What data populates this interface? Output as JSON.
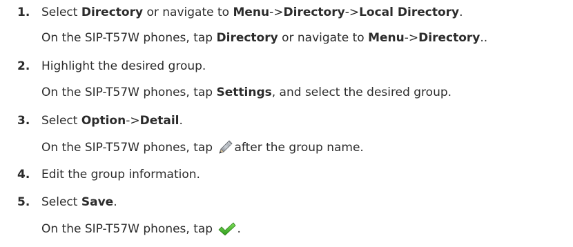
{
  "steps": [
    {
      "num": "1.",
      "main": {
        "a": "Select ",
        "b": "Directory",
        "c": " or navigate to ",
        "d": "Menu",
        "e": "->",
        "f": "Directory",
        "g": "->",
        "h": "Local Directory",
        "i": "."
      },
      "sub": {
        "a": "On the SIP-T57W phones, tap ",
        "b": "Directory",
        "c": " or navigate to ",
        "d": "Menu",
        "e": "->",
        "f": "Directory",
        "g": ".."
      }
    },
    {
      "num": "2.",
      "main": {
        "a": "Highlight the desired group."
      },
      "sub": {
        "a": "On the SIP-T57W phones, tap ",
        "b": "Settings",
        "c": ", and select the desired group."
      }
    },
    {
      "num": "3.",
      "main": {
        "a": "Select ",
        "b": "Option",
        "c": "->",
        "d": "Detail",
        "e": "."
      },
      "sub": {
        "a": "On the SIP-T57W phones, tap ",
        "icon": "pencil-edit-icon",
        "b": "after the group name."
      }
    },
    {
      "num": "4.",
      "main": {
        "a": "Edit the group information."
      }
    },
    {
      "num": "5.",
      "main": {
        "a": "Select ",
        "b": "Save",
        "c": "."
      },
      "sub": {
        "a": "On the SIP-T57W phones, tap ",
        "icon": "checkmark-icon",
        "b": "."
      }
    }
  ]
}
